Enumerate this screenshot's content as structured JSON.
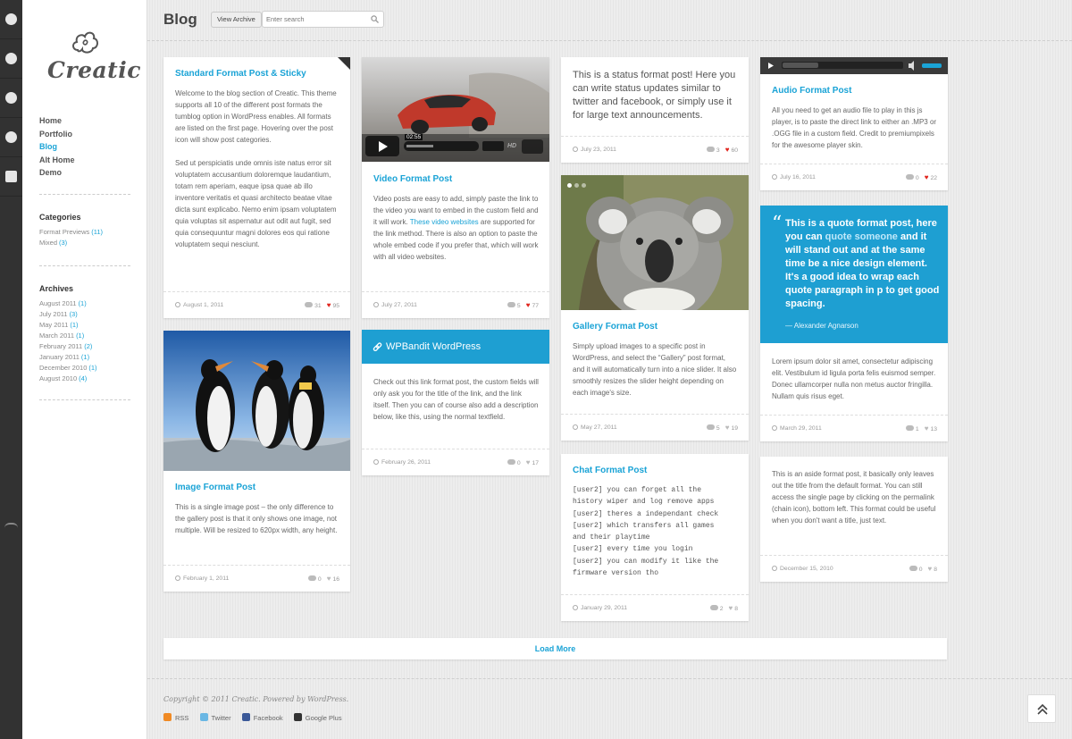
{
  "social": [
    "dribbble-icon",
    "twitter-icon",
    "facebook-icon",
    "chat-icon",
    "basket-icon"
  ],
  "logo": {
    "text": "Creatic"
  },
  "nav": [
    "Home",
    "Portfolio",
    "Blog",
    "Alt Home",
    "Demo"
  ],
  "nav_active": "Blog",
  "categories": {
    "heading": "Categories",
    "items": [
      {
        "label": "Format Previews",
        "count": "(11)"
      },
      {
        "label": "Mixed",
        "count": "(3)"
      }
    ]
  },
  "archives": {
    "heading": "Archives",
    "items": [
      {
        "label": "August 2011",
        "count": "(1)"
      },
      {
        "label": "July 2011",
        "count": "(3)"
      },
      {
        "label": "May 2011",
        "count": "(1)"
      },
      {
        "label": "March 2011",
        "count": "(1)"
      },
      {
        "label": "February 2011",
        "count": "(2)"
      },
      {
        "label": "January 2011",
        "count": "(1)"
      },
      {
        "label": "December 2010",
        "count": "(1)"
      },
      {
        "label": "August 2010",
        "count": "(4)"
      }
    ]
  },
  "header": {
    "title": "Blog",
    "archive_button": "View Archive",
    "search_placeholder": "Enter search"
  },
  "posts": {
    "sticky": {
      "title": "Standard Format Post & Sticky",
      "p1": "Welcome to the blog section of Creatic. This theme supports all 10 of the different post formats the tumblog option in WordPress enables. All formats are listed on the first page. Hovering over the post icon will show post categories.",
      "p2": "Sed ut perspiciatis unde omnis iste natus error sit voluptatem accusantium doloremque laudantium, totam rem aperiam, eaque ipsa quae ab illo inventore veritatis et quasi architecto beatae vitae dicta sunt explicabo. Nemo enim ipsam voluptatem quia voluptas sit aspernatur aut odit aut fugit, sed quia consequuntur magni dolores eos qui ratione voluptatem sequi nesciunt.",
      "date": "August 1, 2011",
      "comments": "31",
      "likes": "95"
    },
    "image": {
      "title": "Image Format Post",
      "text": "This is a single image post – the only difference to the gallery post is that it only shows one image, not multiple. Will be resized to 620px width, any height.",
      "date": "February 1, 2011",
      "comments": "0",
      "likes": "16"
    },
    "video": {
      "title": "Video Format Post",
      "time": "02:55",
      "hd": "HD",
      "text1": "Video posts are easy to add, simply paste the link to the video you want to embed in the custom field and it will work. ",
      "link": "These video websites",
      "text2": " are supported for the link method. There is also an option to paste the whole embed code if you prefer that, which will work with all video websites.",
      "date": "July 27, 2011",
      "comments": "5",
      "likes": "77"
    },
    "link": {
      "title": "WPBandit WordPress",
      "text": "Check out this link format post, the custom fields will only ask you for the title of the link, and the link itself. Then you can of course also add a description below, like this, using the normal textfield.",
      "date": "February 26, 2011",
      "comments": "0",
      "likes": "17"
    },
    "status": {
      "text": "This is a status format post! Here you can write status updates similar to twitter and facebook, or simply use it for large text announcements.",
      "date": "July 23, 2011",
      "comments": "3",
      "likes": "60"
    },
    "gallery": {
      "title": "Gallery Format Post",
      "text": "Simply upload images to a specific post in WordPress, and select the “Gallery” post format, and it will automatically turn into a nice slider. It also smoothly resizes the slider height depending on each image's size.",
      "date": "May 27, 2011",
      "comments": "5",
      "likes": "19"
    },
    "chat": {
      "title": "Chat Format Post",
      "lines": [
        "[user2] you can forget all the",
        "history wiper and log remove apps",
        "[user2] theres a independant check",
        "[user2] which transfers all games",
        "and their playtime",
        "[user2] every time you login",
        "[user2] you can modify it like the",
        "firmware version tho"
      ],
      "date": "January 29, 2011",
      "comments": "2",
      "likes": "8"
    },
    "audio": {
      "title": "Audio Format Post",
      "text": "All you need to get an audio file to play in this js player, is to paste the direct link to either an .MP3 or .OGG file in a custom field. Credit to premiumpixels for the awesome player skin.",
      "date": "July 16, 2011",
      "comments": "0",
      "likes": "22"
    },
    "quote": {
      "q1": "This is a quote format post, here you can ",
      "qlink": "quote someone",
      "q2": " and it will stand out and at the same time be a nice design element. It's a good idea to wrap each quote paragraph in p to get good spacing.",
      "author": "— Alexander Agnarson",
      "text": "Lorem ipsum dolor sit amet, consectetur adipiscing elit. Vestibulum id ligula porta felis euismod semper. Donec ullamcorper nulla non metus auctor fringilla. Nullam quis risus eget.",
      "date": "March 29, 2011",
      "comments": "1",
      "likes": "13"
    },
    "aside": {
      "text": "This is an aside format post, it basically only leaves out the title from the default format. You can still access the single page by clicking on the permalink (chain icon), bottom left. This format could be useful when you don't want a title, just text.",
      "date": "December 15, 2010",
      "comments": "0",
      "likes": "8"
    }
  },
  "load_more": "Load More",
  "footer": {
    "copyright": "Copyright © 2011 Creatic. Powered by WordPress.",
    "links": [
      "RSS",
      "Twitter",
      "Facebook",
      "Google Plus"
    ]
  },
  "colors": {
    "accent": "#1aa3d6",
    "quote_bg": "#1e9fd2",
    "heart": "#e0241c"
  }
}
